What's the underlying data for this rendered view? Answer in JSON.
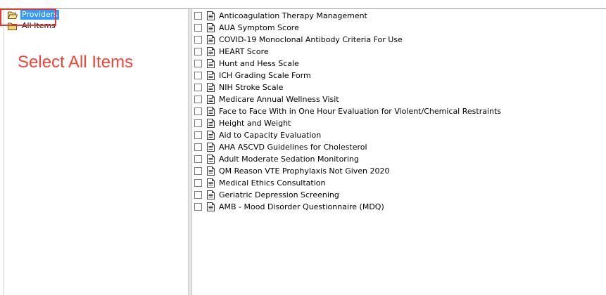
{
  "tree": {
    "items": [
      {
        "label": "Providers",
        "selected": true
      },
      {
        "label": "All Items",
        "selected": false
      }
    ]
  },
  "annotation": {
    "text": "Select All Items",
    "color": "#f44336"
  },
  "checklist": {
    "items": [
      {
        "label": "Anticoagulation Therapy Management",
        "checked": false
      },
      {
        "label": "AUA Symptom Score",
        "checked": false
      },
      {
        "label": "COVID-19 Monoclonal Antibody Criteria For Use",
        "checked": false
      },
      {
        "label": "HEART Score",
        "checked": false
      },
      {
        "label": "Hunt and Hess Scale",
        "checked": false
      },
      {
        "label": "ICH Grading Scale Form",
        "checked": false
      },
      {
        "label": "NIH Stroke Scale",
        "checked": false
      },
      {
        "label": "Medicare Annual Wellness Visit",
        "checked": false
      },
      {
        "label": "Face to Face With in One Hour Evaluation for Violent/Chemical Restraints",
        "checked": false
      },
      {
        "label": "Height and Weight",
        "checked": false
      },
      {
        "label": "Aid to Capacity Evaluation",
        "checked": false
      },
      {
        "label": "AHA ASCVD Guidelines for Cholesterol",
        "checked": false
      },
      {
        "label": "Adult Moderate Sedation Monitoring",
        "checked": false
      },
      {
        "label": "QM Reason VTE Prophylaxis Not Given 2020",
        "checked": false
      },
      {
        "label": "Medical Ethics Consultation",
        "checked": false
      },
      {
        "label": "Geriatric Depression Screening",
        "checked": false
      },
      {
        "label": "AMB - Mood Disorder Questionnaire (MDQ)",
        "checked": false
      }
    ]
  },
  "colors": {
    "selection": "#3399ff",
    "highlight": "#e53935",
    "folder": "#f3d36b"
  },
  "icons": {
    "folder_open": "folder-open-icon",
    "folder": "folder-icon",
    "document": "document-icon"
  }
}
